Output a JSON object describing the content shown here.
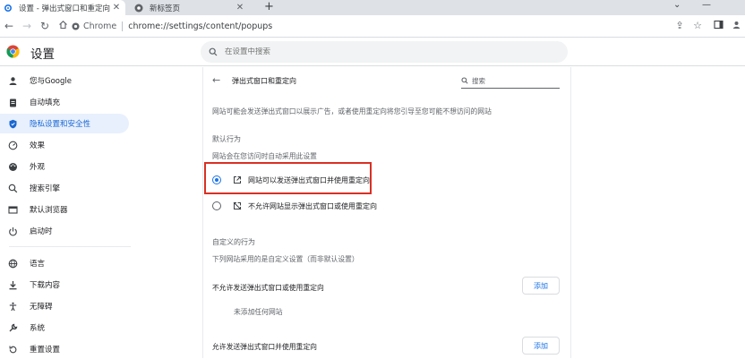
{
  "tabs": [
    {
      "title": "设置 - 弹出式窗口和重定向",
      "active": true
    },
    {
      "title": "新标签页",
      "active": false
    }
  ],
  "omnibox": {
    "site_chip": "Chrome",
    "url": "chrome://settings/content/popups"
  },
  "header": {
    "title": "设置",
    "search_placeholder": "在设置中搜索"
  },
  "sidebar": {
    "items": [
      {
        "label": "您与Google",
        "icon": "person-icon"
      },
      {
        "label": "自动填充",
        "icon": "clipboard-icon"
      },
      {
        "label": "隐私设置和安全性",
        "icon": "shield-icon",
        "selected": true
      },
      {
        "label": "效果",
        "icon": "gauge-icon"
      },
      {
        "label": "外观",
        "icon": "palette-icon"
      },
      {
        "label": "搜索引擎",
        "icon": "search-icon"
      },
      {
        "label": "默认浏览器",
        "icon": "browser-icon"
      },
      {
        "label": "启动时",
        "icon": "power-icon"
      },
      {
        "label": "语言",
        "icon": "globe-icon"
      },
      {
        "label": "下载内容",
        "icon": "download-icon"
      },
      {
        "label": "无障碍",
        "icon": "accessibility-icon"
      },
      {
        "label": "系统",
        "icon": "wrench-icon"
      },
      {
        "label": "重置设置",
        "icon": "reset-icon"
      }
    ]
  },
  "content": {
    "title": "弹出式窗口和重定向",
    "search_placeholder": "搜索",
    "description": "网站可能会发送弹出式窗口以展示广告，或者使用重定向将您引导至您可能不想访问的网站",
    "default_behavior": {
      "title": "默认行为",
      "subtitle": "网站会在您访问时自动采用此设置",
      "options": [
        {
          "label": "网站可以发送弹出式窗口并使用重定向",
          "selected": true
        },
        {
          "label": "不允许网站显示弹出式窗口或使用重定向",
          "selected": false
        }
      ]
    },
    "custom_behavior": {
      "title": "自定义的行为",
      "subtitle": "下列网站采用的是自定义设置（而非默认设置）",
      "block_label": "不允许发送弹出式窗口或使用重定向",
      "add_label": "添加",
      "empty_label": "未添加任何网站",
      "allow_label": "允许发送弹出式窗口并使用重定向",
      "add_label_2": "添加"
    }
  },
  "colors": {
    "accent": "#1a73e8",
    "highlight_border": "#d93025",
    "sidebar_selected_bg": "#e8f0fe"
  }
}
